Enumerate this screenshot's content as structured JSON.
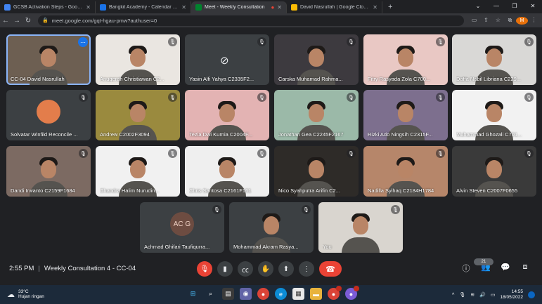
{
  "browser": {
    "tabs": [
      {
        "title": "GCSB Activation Steps - Google D",
        "favicon_color": "#4285f4"
      },
      {
        "title": "Bangkit Academy - Calendar - M",
        "favicon_color": "#1a73e8"
      },
      {
        "title": "Meet - Weekly Consultation",
        "favicon_color": "#00832d",
        "active": true
      },
      {
        "title": "David Nasrullah | Google Cloud S",
        "favicon_color": "#fbbc04"
      }
    ],
    "url": "meet.google.com/gqt-hgau-pmw?authuser=0",
    "profile_initial": "M"
  },
  "participants": [
    {
      "name": "CC-04 David Nasrullah",
      "speaking": true,
      "muted": false,
      "bg": "#6d5f52"
    },
    {
      "name": "Anugerah Christiawan C2...",
      "muted": true,
      "bg": "#eae6e1"
    },
    {
      "name": "Yasin Alfi Yahya C2335F2...",
      "muted": true,
      "camera_off": true,
      "bg": "#3c4043"
    },
    {
      "name": "Carska Muhamad Rahma...",
      "muted": true,
      "bg": "#3d3a3f"
    },
    {
      "name": "Fitry Rasyada Zola C700...",
      "muted": true,
      "bg": "#e9c8c4"
    },
    {
      "name": "Daffa Nabil Libriana C229...",
      "muted": true,
      "bg": "#d9d8d6"
    },
    {
      "name": "Solvatar Winfild Reconcile ...",
      "muted": true,
      "avatar": true,
      "bg": "#3c4043"
    },
    {
      "name": "Andrew C2002F3094",
      "muted": true,
      "bg": "#9a8a3e"
    },
    {
      "name": "Tezia Dwi Kurnia C2004F...",
      "muted": true,
      "bg": "#e3b3b3"
    },
    {
      "name": "Jonathan Gea C2245F2167",
      "muted": true,
      "bg": "#9bb9a8"
    },
    {
      "name": "Rizki Ado Ningsih C2315F...",
      "muted": true,
      "bg": "#7d6f8e"
    },
    {
      "name": "Muhammad Ghozali C701...",
      "muted": true,
      "bg": "#f2f2f2"
    },
    {
      "name": "Dandi Irwanto C2159F1684",
      "muted": true,
      "bg": "#7c6a62"
    },
    {
      "name": "Chandra Halim Nurudin...",
      "muted": true,
      "bg": "#f1f1f1"
    },
    {
      "name": "Chris Santosa C2161F161",
      "muted": true,
      "bg": "#efefef"
    },
    {
      "name": "Nico Syahputra Arifin C2...",
      "muted": true,
      "bg": "#2e2b28"
    },
    {
      "name": "Nadilla Syihaq C2184H1784",
      "muted": true,
      "bg": "#b6866a"
    },
    {
      "name": "Alvin Steven C2007F0655",
      "muted": true,
      "bg": "#3a3a3a"
    },
    {
      "name": "Achmad Ghifari Taufiqurra...",
      "muted": true,
      "initials": "AC G",
      "bg": "#3c4043"
    },
    {
      "name": "Mohammad Akram Rasya...",
      "muted": true,
      "bg": "#3c4043"
    },
    {
      "name": "You",
      "muted": true,
      "bg": "#d9d5cf"
    }
  ],
  "meeting": {
    "time": "2:55 PM",
    "title": "Weekly Consultation 4 - CC-04",
    "participant_count": "21"
  },
  "taskbar": {
    "temperature": "33°C",
    "weather": "Hujan ringan",
    "time": "14:55",
    "date": "18/05/2022"
  }
}
